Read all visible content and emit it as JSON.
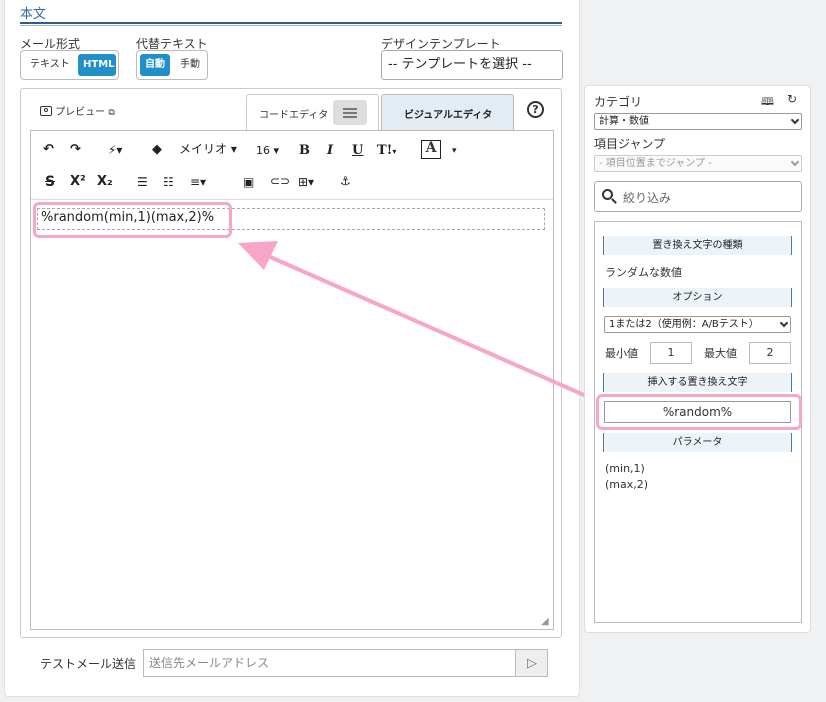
{
  "section": {
    "title": "本文"
  },
  "mail_format": {
    "label": "メール形式",
    "options": [
      "テキスト",
      "HTML"
    ],
    "selected": "HTML"
  },
  "alt_text": {
    "label": "代替テキスト",
    "options": [
      "自動",
      "手動"
    ],
    "selected": "自動"
  },
  "design_template": {
    "label": "デザインテンプレート",
    "value": "-- テンプレートを選択 --"
  },
  "editor": {
    "preview_label": "プレビュー",
    "tabs": [
      {
        "label": "コードエディタ"
      },
      {
        "label": "ビジュアルエディタ"
      }
    ],
    "active_tab": "ビジュアルエディタ",
    "help": "?",
    "toolbar": {
      "font_label": "メイリオ",
      "size_label": "16",
      "bold": "B",
      "italic": "I",
      "underline": "U",
      "text_style": "T!",
      "font_color": "A",
      "strike": "S",
      "superscript": "X²",
      "subscript": "X₂"
    },
    "content": "%random(min,1)(max,2)%"
  },
  "test_mail": {
    "label": "テストメール送信",
    "placeholder": "送信先メールアドレス"
  },
  "side": {
    "category_label": "カテゴリ",
    "category_value": "計算・数値",
    "jump_label": "項目ジャンプ",
    "jump_value": "- 項目位置までジャンプ -",
    "filter_placeholder": "絞り込み",
    "type_header": "置き換え文字の種類",
    "type_value": "ランダムな数値",
    "option_header": "オプション",
    "option_value": "1または2（使用例：A/Bテスト）",
    "min_label": "最小値",
    "min_value": "1",
    "max_label": "最大値",
    "max_value": "2",
    "insert_header": "挿入する置き換え文字",
    "insert_value": "%random%",
    "param_header": "パラメータ",
    "params": [
      "(min,1)",
      "(max,2)"
    ]
  },
  "colors": {
    "accent": "#2190c8",
    "highlight": "#f7a6c9",
    "header_bar": "#ecf3f9"
  }
}
